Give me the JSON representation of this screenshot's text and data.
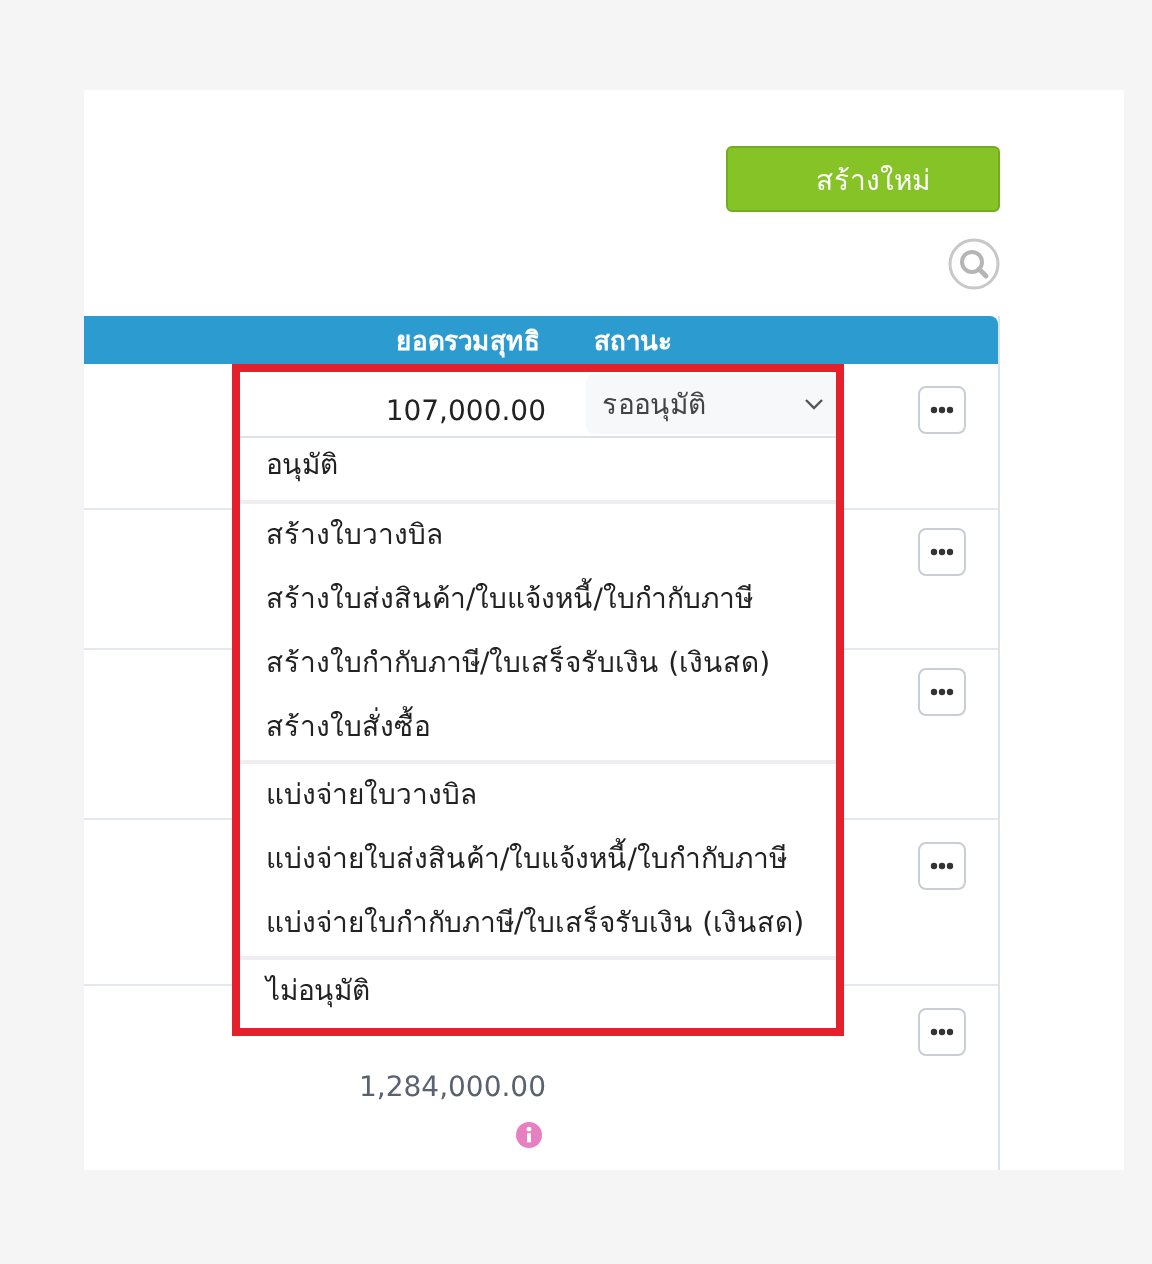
{
  "toolbar": {
    "create_button": "สร้างใหม่"
  },
  "table": {
    "columns": [
      "ยอดรวมสุทธิ",
      "สถานะ"
    ],
    "rows": [
      {
        "kind": "status-select",
        "amount": "107,000.00",
        "status": "รออนุมัติ"
      },
      {
        "kind": "plain"
      },
      {
        "kind": "plain"
      },
      {
        "kind": "plain"
      },
      {
        "kind": "amount-info",
        "amount": "1,284,000.00"
      }
    ]
  },
  "status_menu": {
    "groups": [
      [
        "อนุมัติ"
      ],
      [
        "สร้างใบวางบิล",
        "สร้างใบส่งสินค้า/ใบแจ้งหนี้/ใบกำกับภาษี",
        "สร้างใบกำกับภาษี/ใบเสร็จรับเงิน (เงินสด)",
        "สร้างใบสั่งซื้อ"
      ],
      [
        "แบ่งจ่ายใบวางบิล",
        "แบ่งจ่ายใบส่งสินค้า/ใบแจ้งหนี้/ใบกำกับภาษี",
        "แบ่งจ่ายใบกำกับภาษี/ใบเสร็จรับเงิน (เงินสด)"
      ],
      [
        "ไม่อนุมัติ"
      ]
    ]
  }
}
